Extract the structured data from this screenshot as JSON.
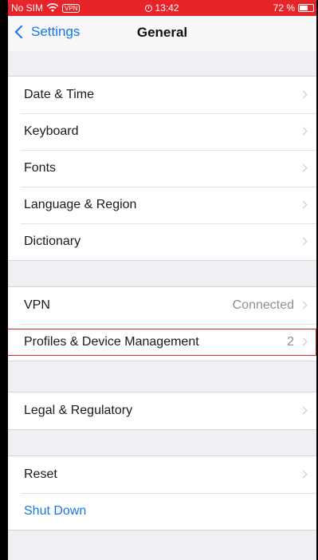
{
  "status_bar": {
    "carrier": "No SIM",
    "vpn_badge": "VPN",
    "time": "13:42",
    "battery_percent": "72 %",
    "battery_level": 0.72,
    "background_color": "#e8242b"
  },
  "nav_bar": {
    "back_label": "Settings",
    "title": "General"
  },
  "groups": [
    {
      "rows": [
        {
          "label": "Date & Time",
          "value": ""
        },
        {
          "label": "Keyboard",
          "value": ""
        },
        {
          "label": "Fonts",
          "value": ""
        },
        {
          "label": "Language & Region",
          "value": ""
        },
        {
          "label": "Dictionary",
          "value": ""
        }
      ]
    },
    {
      "rows": [
        {
          "label": "VPN",
          "value": "Connected"
        },
        {
          "label": "Profiles & Device Management",
          "value": "2"
        }
      ]
    },
    {
      "rows": [
        {
          "label": "Legal & Regulatory",
          "value": ""
        }
      ]
    },
    {
      "rows": [
        {
          "label": "Reset",
          "value": ""
        },
        {
          "label": "Shut Down",
          "value": ""
        }
      ]
    }
  ],
  "colors": {
    "accent": "#1676e8",
    "highlight_border": "#d62b2b"
  }
}
